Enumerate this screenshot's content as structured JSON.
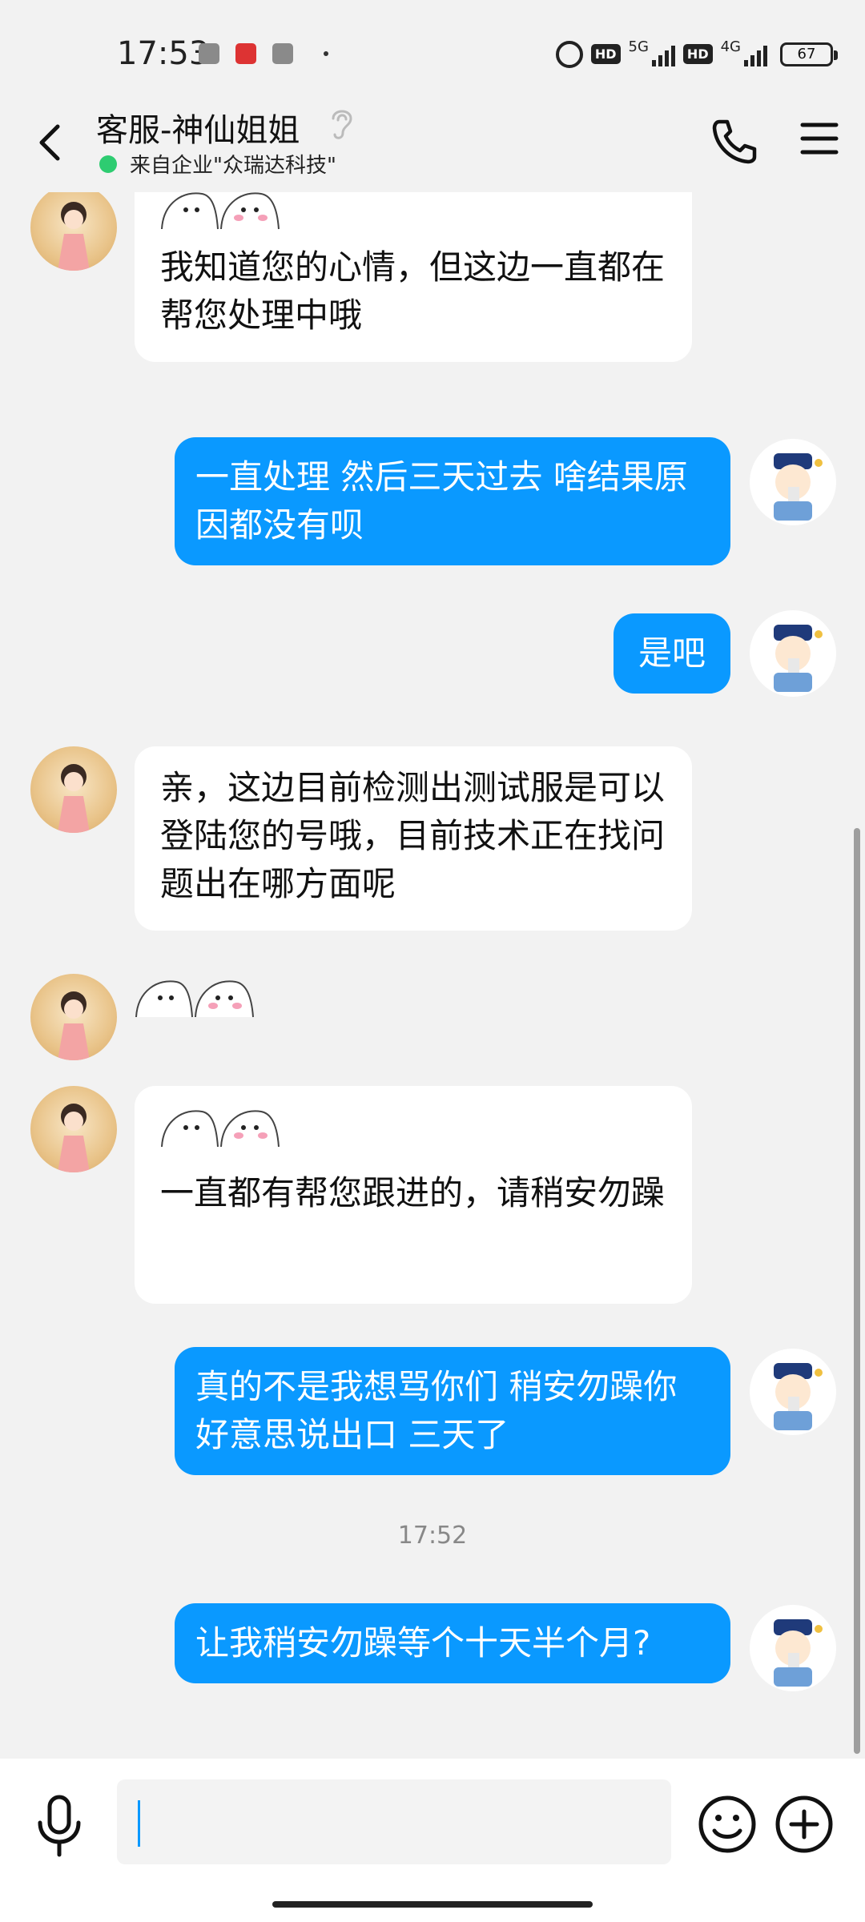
{
  "status_bar": {
    "time": "17:53",
    "net1": "5G",
    "net2": "4G",
    "hd": "HD",
    "battery": "67"
  },
  "header": {
    "title": "客服-神仙姐姐",
    "subtitle": "来自企业\"众瑞达科技\""
  },
  "messages": [
    {
      "from": "agent",
      "sticker": true,
      "text": "我知道您的心情，但这边一直都在帮您处理中哦"
    },
    {
      "from": "user",
      "text": "一直处理 然后三天过去 啥结果原因都没有呗"
    },
    {
      "from": "user",
      "text": "是吧"
    },
    {
      "from": "agent",
      "text": "亲，这边目前检测出测试服是可以登陆您的号哦，目前技术正在找问题出在哪方面呢"
    },
    {
      "from": "agent",
      "sticker_only": true
    },
    {
      "from": "agent",
      "sticker": true,
      "text": "一直都有帮您跟进的，请稍安勿躁"
    },
    {
      "from": "user",
      "text": "真的不是我想骂你们 稍安勿躁你好意思说出口 三天了"
    },
    {
      "timestamp": "17:52"
    },
    {
      "from": "user",
      "text": "让我稍安勿躁等个十天半个月?"
    }
  ],
  "input": {
    "value": "",
    "placeholder": ""
  },
  "colors": {
    "accent": "#0a99ff",
    "background": "#f2f2f2",
    "online": "#2ecc71"
  },
  "icons": [
    "back-arrow-icon",
    "ear-icon",
    "phone-icon",
    "menu-icon",
    "microphone-icon",
    "emoji-icon",
    "plus-icon"
  ]
}
